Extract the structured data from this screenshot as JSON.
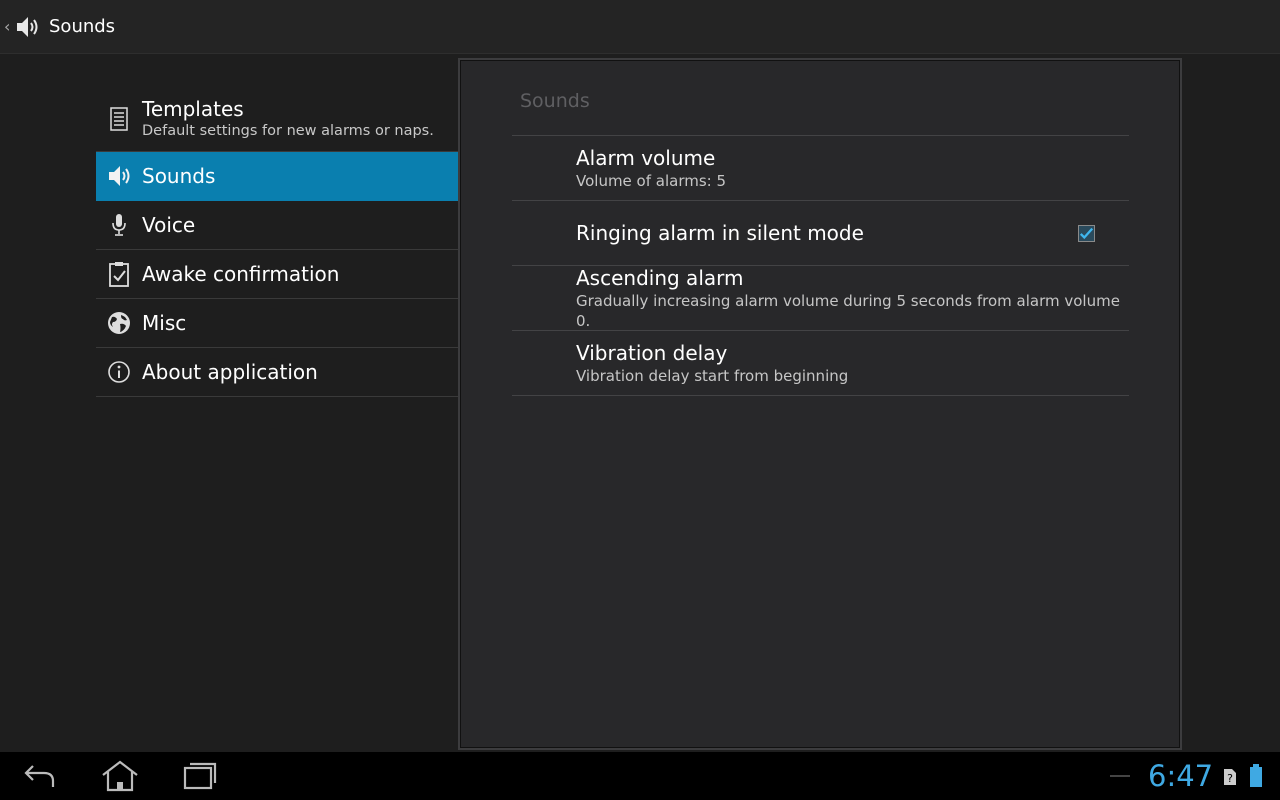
{
  "action_bar": {
    "title": "Sounds",
    "icon": "speaker-icon"
  },
  "headers": [
    {
      "label": "Templates",
      "summary": "Default settings for new alarms or naps.",
      "icon": "document-icon",
      "active": false
    },
    {
      "label": "Sounds",
      "icon": "speaker-icon",
      "active": true
    },
    {
      "label": "Voice",
      "icon": "microphone-icon",
      "active": false
    },
    {
      "label": "Awake confirmation",
      "icon": "clipboard-check-icon",
      "active": false
    },
    {
      "label": "Misc",
      "icon": "globe-icon",
      "active": false
    },
    {
      "label": "About application",
      "icon": "info-icon",
      "active": false
    }
  ],
  "panel": {
    "title": "Sounds",
    "prefs": [
      {
        "title": "Alarm volume",
        "summary": "Volume of alarms: 5"
      },
      {
        "title": "Ringing alarm in silent mode",
        "checked": true
      },
      {
        "title": "Ascending alarm",
        "summary": "Gradually increasing alarm volume during 5 seconds from alarm volume 0."
      },
      {
        "title": "Vibration delay",
        "summary": "Vibration delay start from beginning"
      }
    ]
  },
  "system_bar": {
    "time": "6:47"
  },
  "colors": {
    "accent": "#0a7faf",
    "clock": "#3fa9e3"
  }
}
